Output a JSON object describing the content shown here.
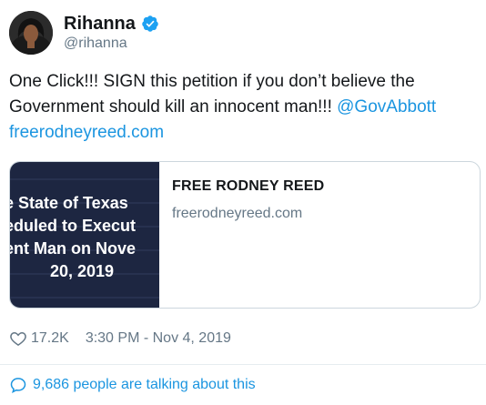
{
  "tweet": {
    "author": {
      "display_name": "Rihanna",
      "handle": "@rihanna",
      "verified": true
    },
    "text_main": "One Click!!! SIGN this petition if you don’t believe the Government should kill an innocent man!!! ",
    "mention": "@GovAbbott",
    "url": "freerodneyreed.com",
    "card": {
      "image_lines": [
        "e State of Texas",
        "eduled to Execut",
        "ent Man on Nove",
        "20, 2019"
      ],
      "title": "FREE RODNEY REED",
      "domain": "freerodneyreed.com"
    },
    "likes": "17.2K",
    "timestamp": "3:30 PM - Nov 4, 2019",
    "talking": "9,686 people are talking about this"
  },
  "colors": {
    "link": "#1b95e0",
    "secondary_text": "#657786",
    "card_image_bg": "#1d2641"
  },
  "icons": [
    "verified-badge-icon",
    "heart-icon",
    "speech-bubble-icon"
  ]
}
